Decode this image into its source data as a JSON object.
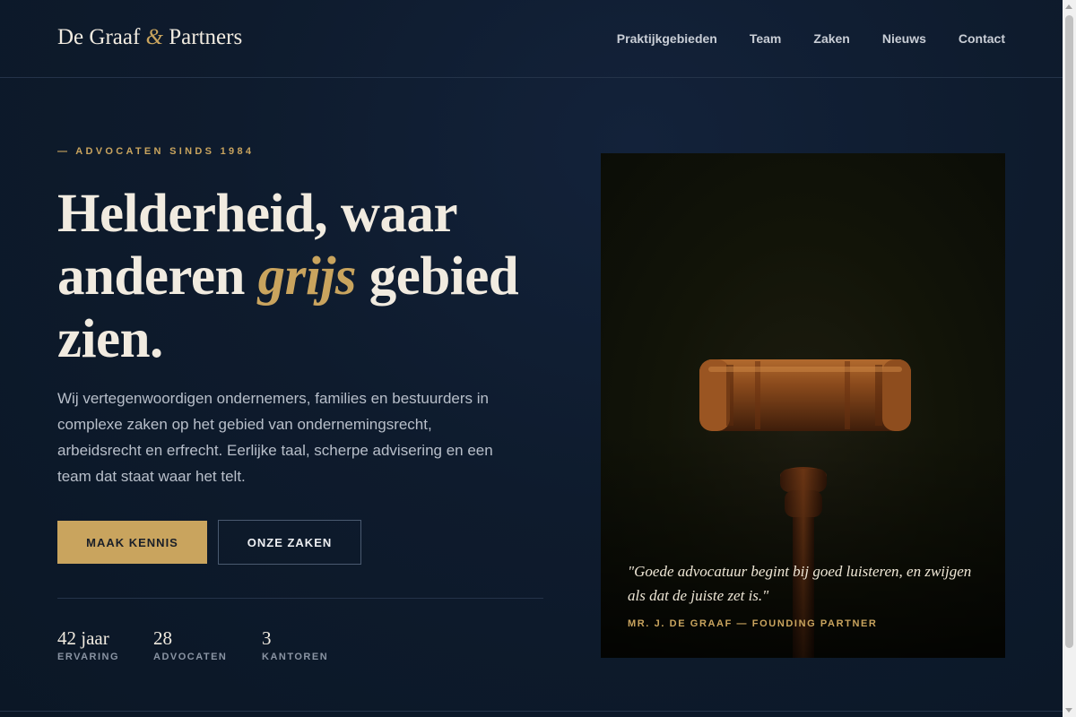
{
  "header": {
    "logo": {
      "name_part1": "De Graaf ",
      "amp": "&",
      "name_part2": " Partners"
    },
    "nav": [
      "Praktijkgebieden",
      "Team",
      "Zaken",
      "Nieuws",
      "Contact"
    ]
  },
  "hero": {
    "eyebrow": "— ADVOCATEN SINDS 1984",
    "headline": {
      "line1": "Helderheid, waar",
      "line2_before": "anderen ",
      "line2_accent": "grijs",
      "line2_after": " gebied",
      "line3": "zien."
    },
    "lead": "Wij vertegenwoordigen ondernemers, families en bestuurders in complexe zaken op het gebied van ondernemingsrecht, arbeidsrecht en erfrecht. Eerlijke taal, scherpe advisering en een team dat staat waar het telt.",
    "primary_button": "MAAK KENNIS",
    "secondary_button": "ONZE ZAKEN",
    "stats": [
      {
        "value": "42 jaar",
        "label": "ERVARING"
      },
      {
        "value": "28",
        "label": "ADVOCATEN"
      },
      {
        "value": "3",
        "label": "KANTOREN"
      }
    ]
  },
  "feature": {
    "image_icon": "gavel-icon",
    "quote": "\"Goede advocatuur begint bij goed luisteren, en zwijgen als dat de juiste zet is.\"",
    "author": "MR. J. DE GRAAF — FOUNDING PARTNER"
  },
  "colors": {
    "background": "#0d1a2b",
    "accent": "#c9a45e",
    "text": "#f1ebe0"
  }
}
